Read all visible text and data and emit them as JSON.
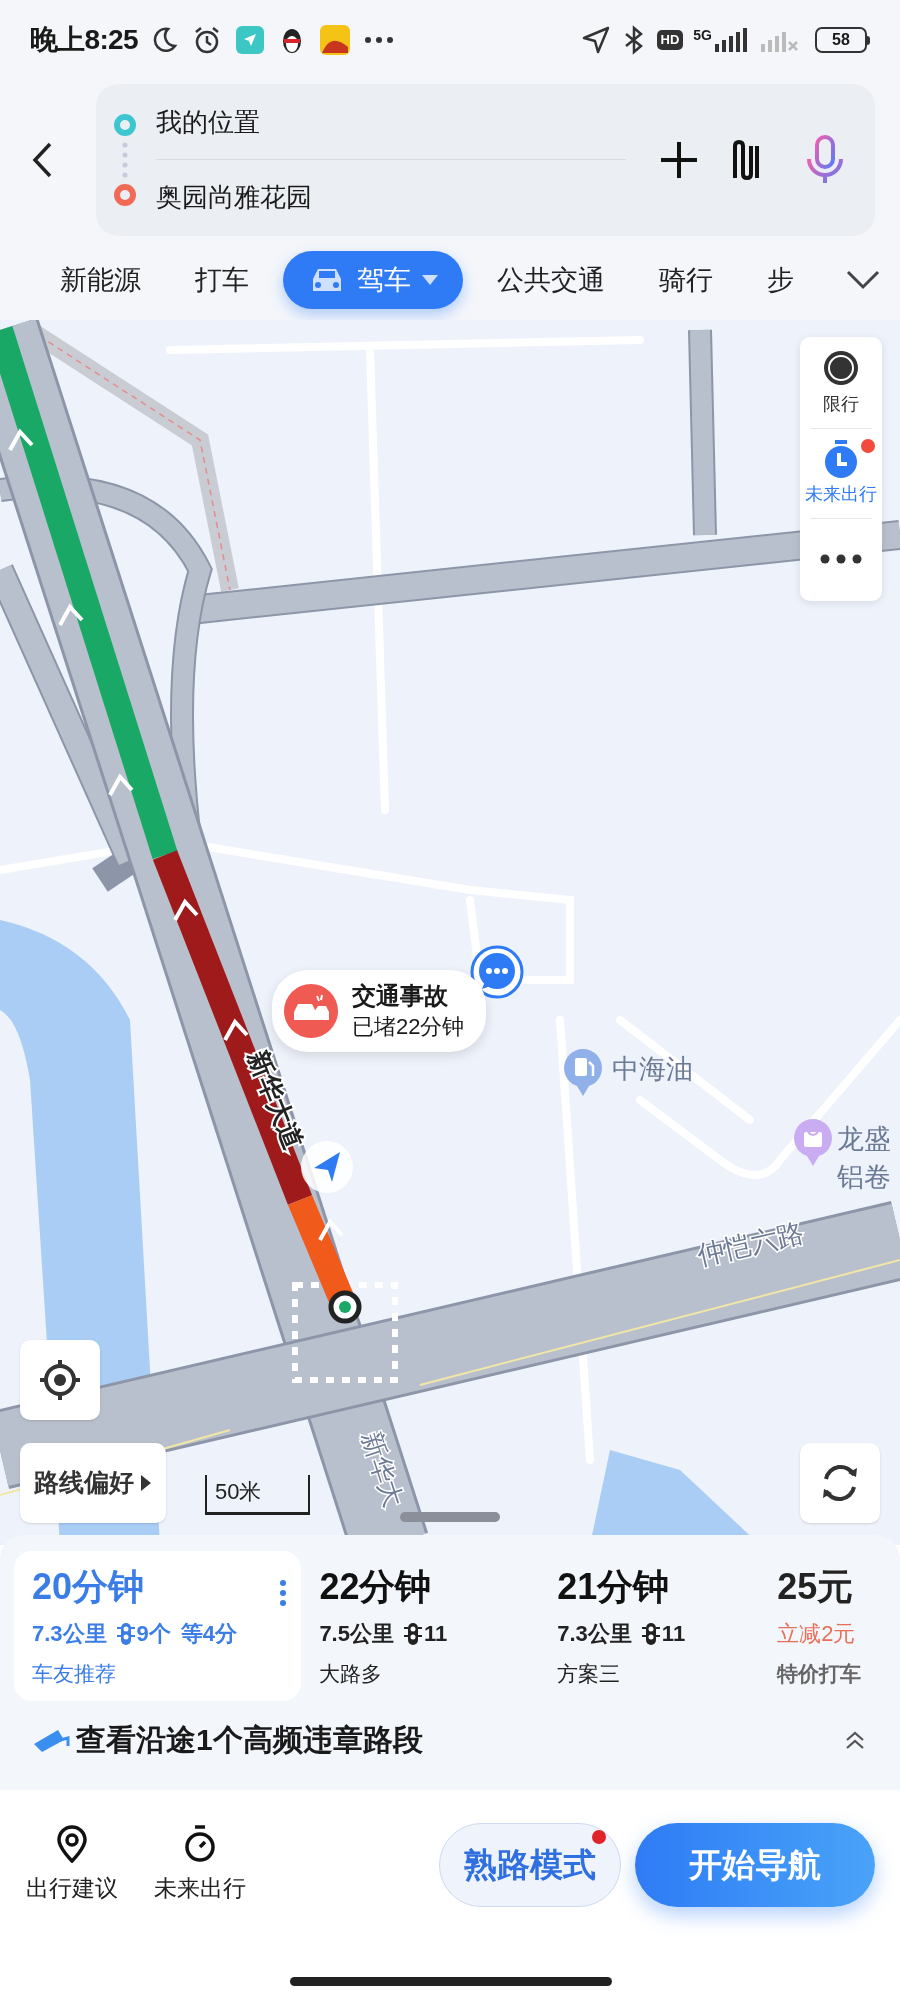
{
  "status_bar": {
    "time": "晚上8:25",
    "hd": "HD",
    "network": "5G",
    "battery": "58"
  },
  "search": {
    "origin": "我的位置",
    "destination": "奥园尚雅花园"
  },
  "modes": [
    {
      "label": "新能源",
      "selected": false
    },
    {
      "label": "打车",
      "selected": false
    },
    {
      "label": "驾车",
      "selected": true
    },
    {
      "label": "公共交通",
      "selected": false
    },
    {
      "label": "骑行",
      "selected": false
    },
    {
      "label": "步",
      "selected": false
    }
  ],
  "map_tools": [
    {
      "kind": "restriction",
      "label": "限行"
    },
    {
      "kind": "future",
      "label": "未来出行"
    },
    {
      "kind": "more"
    }
  ],
  "incident": {
    "title": "交通事故",
    "detail": "已堵22分钟"
  },
  "map_labels": {
    "roads": [
      "新华大道",
      "仲恺六路",
      "新华大"
    ],
    "pois": [
      {
        "kind": "fuel",
        "lines": [
          "中海油"
        ]
      },
      {
        "kind": "shop",
        "lines": [
          "龙盛",
          "铝卷"
        ]
      }
    ]
  },
  "route_preference": "路线偏好",
  "scale": "50米",
  "routes": [
    {
      "time": "20分钟",
      "distance": "7.3公里",
      "lights": "9个",
      "wait": "等4分",
      "tag": "车友推荐",
      "selected": true
    },
    {
      "time": "22分钟",
      "distance": "7.5公里",
      "lights": "11",
      "tag": "大路多",
      "selected": false
    },
    {
      "time": "21分钟",
      "distance": "7.3公里",
      "lights": "11",
      "tag": "方案三",
      "selected": false
    }
  ],
  "taxi": {
    "price": "25元",
    "discount": "立减2元",
    "label": "特价打车"
  },
  "violation_notice": "查看沿途1个高频违章路段",
  "bottom_actions": [
    {
      "kind": "suggest",
      "label": "出行建议"
    },
    {
      "kind": "future",
      "label": "未来出行"
    }
  ],
  "familiar_mode": {
    "label": "熟路模式",
    "badge": true
  },
  "start_button": "开始导航"
}
